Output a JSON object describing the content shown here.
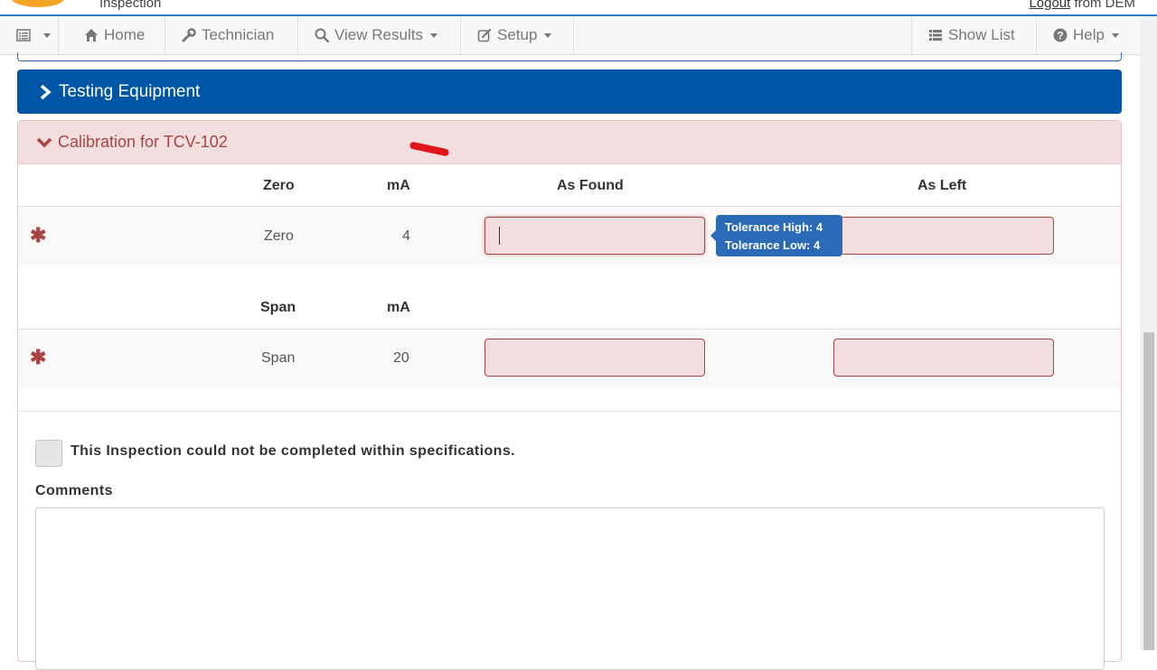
{
  "header": {
    "app_subtitle": "Inspection",
    "logout_label": "Logout",
    "logout_suffix": "from DEM"
  },
  "navbar": {
    "items": [
      {
        "label": "Home",
        "icon": "home-icon"
      },
      {
        "label": "Technician",
        "icon": "wrench-icon"
      },
      {
        "label": "View Results",
        "icon": "search-icon"
      },
      {
        "label": "Setup",
        "icon": "edit-icon"
      }
    ],
    "right_items": [
      {
        "label": "Show List",
        "icon": "list-icon"
      },
      {
        "label": "Help",
        "icon": "question-circle-icon"
      }
    ]
  },
  "testing_equipment": {
    "title": "Testing Equipment"
  },
  "calibration": {
    "title": "Calibration for TCV-102",
    "col_as_found": "As Found",
    "col_as_left": "As Left",
    "zero": {
      "group_label": "Zero",
      "unit_label": "mA",
      "row_label": "Zero",
      "value": "4",
      "as_found": "",
      "as_left": ""
    },
    "span": {
      "group_label": "Span",
      "unit_label": "mA",
      "row_label": "Span",
      "value": "20",
      "as_found": "",
      "as_left": ""
    },
    "required_marker": "✱",
    "tooltip": {
      "line1": "Tolerance High: 4",
      "line2": "Tolerance Low: 4"
    }
  },
  "form": {
    "checkbox_label": "This Inspection could not be completed within specifications.",
    "checkbox_checked": false,
    "comments_label": "Comments",
    "comments_value": ""
  },
  "colors": {
    "primary_blue": "#0056a6",
    "danger_bg": "#f2dede",
    "danger_text": "#a94442"
  }
}
